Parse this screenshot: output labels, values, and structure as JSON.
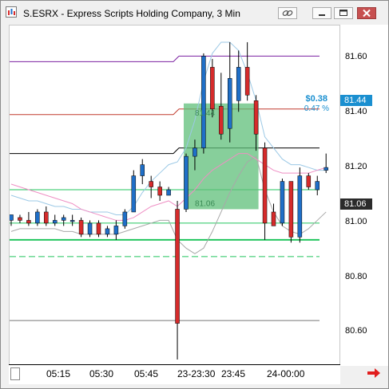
{
  "window": {
    "title": "S.ESRX - Express Scripts Holding Company, 3 Min"
  },
  "titlebar_buttons": [
    "link-icon",
    "minimize-icon",
    "restore-icon",
    "close-icon"
  ],
  "price_axis": {
    "ticks": [
      "81.60",
      "81.40",
      "81.20",
      "81.00",
      "80.80",
      "80.60"
    ],
    "last_price": "81.44",
    "secondary_price": "81.06",
    "last_price_color": "#1a8fd0",
    "secondary_price_color": "#2b2b2b"
  },
  "time_axis": {
    "labels": [
      "05:15",
      "05:30",
      "05:45",
      "23-23:30",
      "23:45",
      "24-00:00"
    ]
  },
  "annotations": {
    "measure_change": "$0.38",
    "measure_percent": "0.47 %",
    "box_low_label": "81.06",
    "box_high_label": "81.44"
  },
  "colors": {
    "up_candle": "#1f6fc8",
    "down_candle": "#d62b2b",
    "upper_band": "#7a1fa0",
    "resistance": "#c0392b",
    "support_green": "#22c55e",
    "measure_box": "#5fbf7a"
  },
  "chart_data": {
    "type": "candlestick",
    "title": "S.ESRX - Express Scripts Holding Company, 3 Min",
    "ylim": [
      80.5,
      81.72
    ],
    "x_labels": [
      "05:15",
      "05:30",
      "05:45",
      "23-23:30",
      "23:45",
      "24-00:00"
    ],
    "candles": [
      {
        "o": 81.02,
        "h": 81.04,
        "l": 81.0,
        "c": 81.04
      },
      {
        "o": 81.03,
        "h": 81.04,
        "l": 81.01,
        "c": 81.02
      },
      {
        "o": 81.02,
        "h": 81.05,
        "l": 81.0,
        "c": 81.01
      },
      {
        "o": 81.01,
        "h": 81.06,
        "l": 81.0,
        "c": 81.05
      },
      {
        "o": 81.05,
        "h": 81.07,
        "l": 81.0,
        "c": 81.01
      },
      {
        "o": 81.01,
        "h": 81.04,
        "l": 81.0,
        "c": 81.02
      },
      {
        "o": 81.02,
        "h": 81.04,
        "l": 81.0,
        "c": 81.03
      },
      {
        "o": 81.02,
        "h": 81.04,
        "l": 81.0,
        "c": 81.02
      },
      {
        "o": 81.02,
        "h": 81.03,
        "l": 80.96,
        "c": 80.97
      },
      {
        "o": 80.97,
        "h": 81.02,
        "l": 80.96,
        "c": 81.01
      },
      {
        "o": 81.01,
        "h": 81.02,
        "l": 80.96,
        "c": 80.97
      },
      {
        "o": 80.97,
        "h": 81.0,
        "l": 80.96,
        "c": 80.99
      },
      {
        "o": 80.97,
        "h": 81.02,
        "l": 80.95,
        "c": 81.0
      },
      {
        "o": 81.0,
        "h": 81.06,
        "l": 80.99,
        "c": 81.05
      },
      {
        "o": 81.05,
        "h": 81.2,
        "l": 81.05,
        "c": 81.18
      },
      {
        "o": 81.18,
        "h": 81.24,
        "l": 81.15,
        "c": 81.22
      },
      {
        "o": 81.16,
        "h": 81.18,
        "l": 81.1,
        "c": 81.14
      },
      {
        "o": 81.14,
        "h": 81.16,
        "l": 81.09,
        "c": 81.11
      },
      {
        "o": 81.11,
        "h": 81.14,
        "l": 81.11,
        "c": 81.13
      },
      {
        "o": 81.06,
        "h": 81.09,
        "l": 80.52,
        "c": 80.65
      },
      {
        "o": 81.06,
        "h": 81.26,
        "l": 81.05,
        "c": 81.25
      },
      {
        "o": 81.25,
        "h": 81.31,
        "l": 81.2,
        "c": 81.28
      },
      {
        "o": 81.28,
        "h": 81.62,
        "l": 81.26,
        "c": 81.61
      },
      {
        "o": 81.57,
        "h": 81.6,
        "l": 81.39,
        "c": 81.42
      },
      {
        "o": 81.43,
        "h": 81.55,
        "l": 81.31,
        "c": 81.33
      },
      {
        "o": 81.35,
        "h": 81.66,
        "l": 81.3,
        "c": 81.53
      },
      {
        "o": 81.45,
        "h": 81.63,
        "l": 81.41,
        "c": 81.57
      },
      {
        "o": 81.57,
        "h": 81.66,
        "l": 81.45,
        "c": 81.47
      },
      {
        "o": 81.45,
        "h": 81.47,
        "l": 81.27,
        "c": 81.33
      },
      {
        "o": 81.28,
        "h": 81.3,
        "l": 80.95,
        "c": 81.01
      },
      {
        "o": 81.05,
        "h": 81.08,
        "l": 81.0,
        "c": 81.0
      },
      {
        "o": 81.01,
        "h": 81.17,
        "l": 81.0,
        "c": 81.16
      },
      {
        "o": 81.16,
        "h": 81.16,
        "l": 80.94,
        "c": 80.96
      },
      {
        "o": 80.96,
        "h": 81.21,
        "l": 80.94,
        "c": 81.18
      },
      {
        "o": 81.18,
        "h": 81.19,
        "l": 81.13,
        "c": 81.14
      },
      {
        "o": 81.13,
        "h": 81.18,
        "l": 81.11,
        "c": 81.16
      },
      {
        "o": 81.2,
        "h": 81.26,
        "l": 81.19,
        "c": 81.21
      }
    ],
    "horizontal_lines": [
      {
        "name": "upper",
        "y": 81.61,
        "color": "#7a1fa0",
        "style": "solid"
      },
      {
        "name": "resistance",
        "y": 81.42,
        "color": "#c0392b",
        "style": "solid"
      },
      {
        "name": "pivot",
        "y": 81.28,
        "color": "#000000",
        "style": "solid"
      },
      {
        "name": "support1",
        "y": 81.13,
        "color": "#22c55e",
        "style": "solid"
      },
      {
        "name": "support2",
        "y": 81.01,
        "color": "#22c55e",
        "style": "solid"
      },
      {
        "name": "support3",
        "y": 80.95,
        "color": "#22c55e",
        "style": "solid"
      },
      {
        "name": "support4",
        "y": 80.89,
        "color": "#22c55e",
        "style": "dashed"
      },
      {
        "name": "lower",
        "y": 80.66,
        "color": "#777777",
        "style": "solid"
      }
    ],
    "bollinger_upper": [
      81.11,
      81.1,
      81.09,
      81.09,
      81.08,
      81.07,
      81.07,
      81.06,
      81.06,
      81.05,
      81.05,
      81.05,
      81.04,
      81.04,
      81.07,
      81.12,
      81.16,
      81.19,
      81.22,
      81.23,
      81.28,
      81.38,
      81.52,
      81.62,
      81.66,
      81.66,
      81.63,
      81.55,
      81.45,
      81.32,
      81.28,
      81.24,
      81.22,
      81.22,
      81.21,
      81.2,
      81.2
    ],
    "bollinger_lower": [
      80.98,
      80.99,
      80.99,
      80.99,
      80.99,
      80.99,
      80.98,
      80.98,
      80.97,
      80.97,
      80.97,
      80.97,
      80.97,
      80.98,
      80.99,
      81.0,
      81.01,
      81.02,
      81.02,
      80.95,
      80.92,
      80.9,
      80.92,
      80.98,
      81.05,
      81.12,
      81.18,
      81.23,
      81.25,
      81.13,
      81.05,
      81.0,
      80.98,
      80.97,
      80.99,
      81.02,
      81.05
    ],
    "moving_average": [
      81.15,
      81.14,
      81.13,
      81.12,
      81.11,
      81.1,
      81.09,
      81.08,
      81.06,
      81.05,
      81.04,
      81.03,
      81.02,
      81.02,
      81.03,
      81.05,
      81.07,
      81.08,
      81.09,
      81.07,
      81.1,
      81.13,
      81.17,
      81.2,
      81.22,
      81.24,
      81.26,
      81.26,
      81.24,
      81.22,
      81.2,
      81.19,
      81.19,
      81.19,
      81.19,
      81.2,
      81.21
    ],
    "measure_box": {
      "start_index": 20,
      "end_index": 28,
      "low": 81.06,
      "high": 81.44
    }
  }
}
